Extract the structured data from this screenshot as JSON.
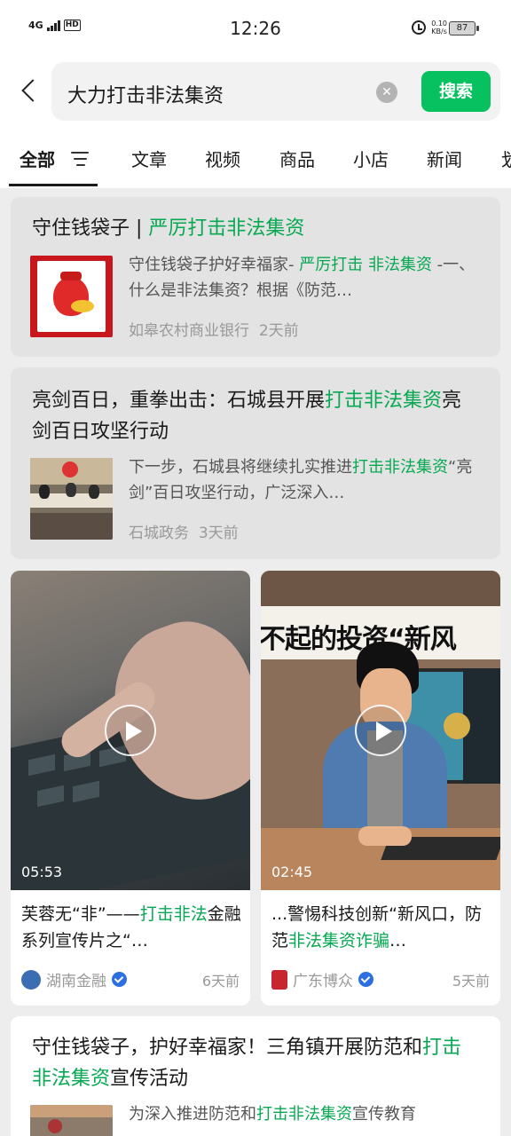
{
  "status_bar": {
    "network": "4G",
    "hd": "HD",
    "time": "12:26",
    "speed_value": "0.10",
    "speed_unit": "KB/s",
    "battery": "87"
  },
  "search": {
    "query": "大力打击非法集资",
    "button_label": "搜索"
  },
  "tabs": [
    {
      "label": "全部",
      "active": true
    },
    {
      "label": "文章"
    },
    {
      "label": "视频"
    },
    {
      "label": "商品"
    },
    {
      "label": "小店"
    },
    {
      "label": "新闻"
    },
    {
      "label": "划"
    }
  ],
  "results": [
    {
      "title_parts": [
        "守住钱袋子 | ",
        "严厉打击非法集资"
      ],
      "desc_parts": [
        "守住钱袋子护好幸福家- ",
        "严厉打击 非法集资",
        " -一、什么是非法集资？根据《防范…"
      ],
      "source": "如皋农村商业银行",
      "time": "2天前"
    },
    {
      "title_parts": [
        "亮剑百日，重拳出击：石城县开展",
        "打击非法集资",
        "亮剑百日攻坚行动"
      ],
      "desc_parts": [
        "下一步，石城县将继续扎实推进",
        "打击非法集资",
        "“亮剑”百日攻坚行动，广泛深入…"
      ],
      "source": "石城政务",
      "time": "3天前"
    },
    {
      "title_parts": [
        "守住钱袋子，护好幸福家！三角镇开展防范和",
        "打击非法集资",
        "宣传活动"
      ],
      "desc_parts": [
        "为深入推进防范和",
        "打击非法集资",
        "宣传教育"
      ]
    }
  ],
  "videos": [
    {
      "duration": "05:53",
      "title_parts": [
        "芙蓉无“非”——",
        "打击非法",
        "金融系列宣传片之“…"
      ],
      "source": "湖南金融",
      "time": "6天前"
    },
    {
      "duration": "02:45",
      "overlay_text": "不起的投资“新风",
      "title_parts": [
        "...警惕科技创新“新风口，防范",
        "非法集资诈骗",
        "…"
      ],
      "source": "广东博众",
      "time": "5天前"
    }
  ],
  "colors": {
    "accent_green": "#07c160",
    "highlight_green": "#07a852",
    "verified_blue": "#2b6fe0"
  }
}
